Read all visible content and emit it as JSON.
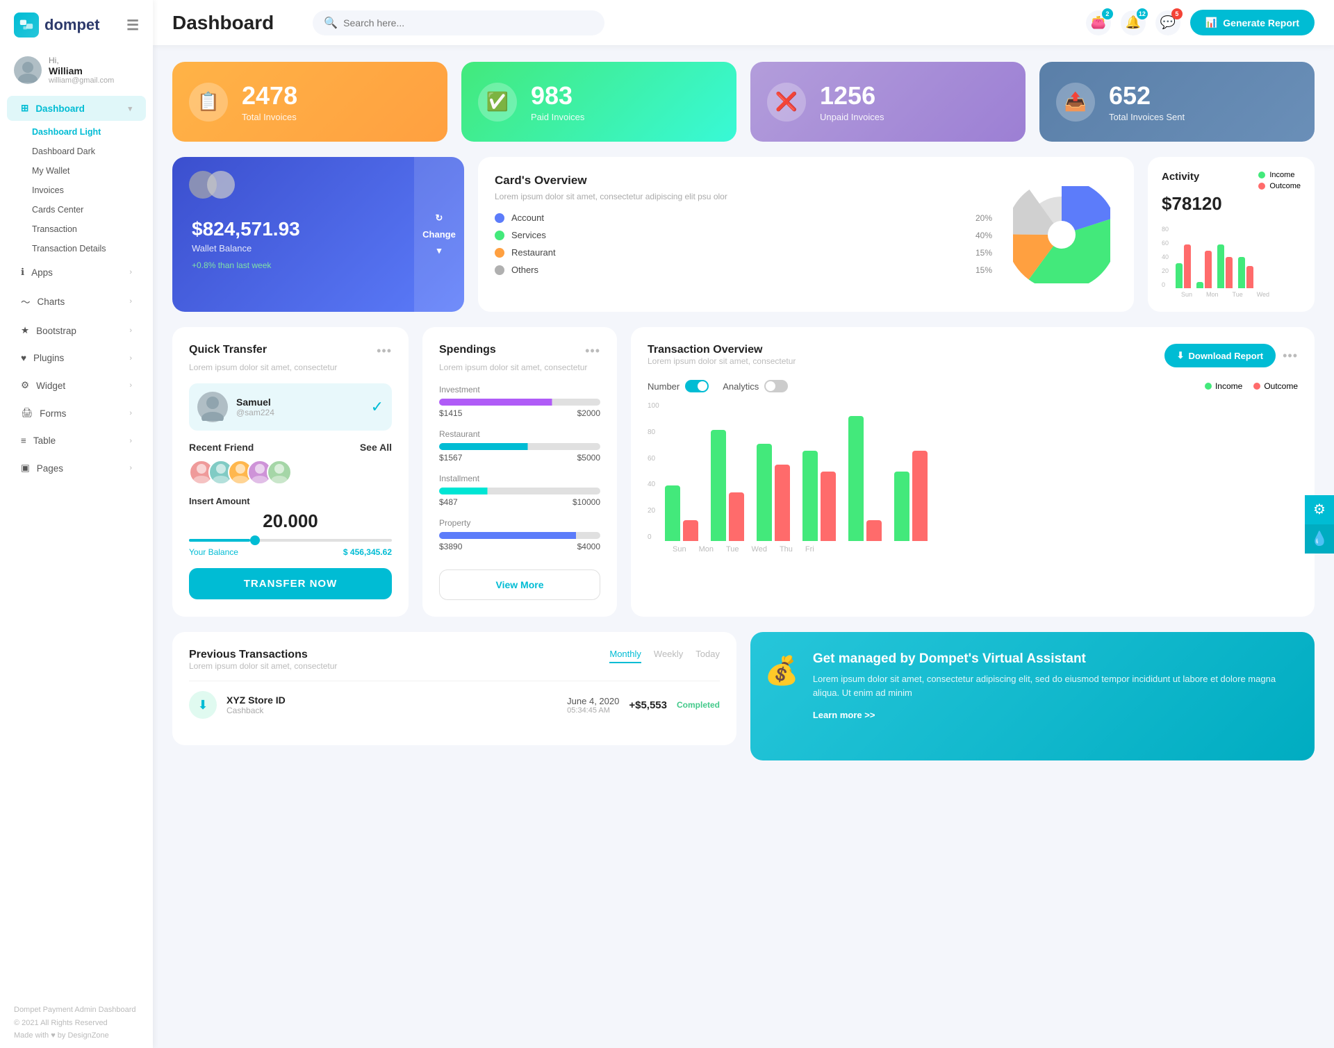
{
  "app": {
    "name": "dompet",
    "title": "Dashboard"
  },
  "header": {
    "title": "Dashboard",
    "search_placeholder": "Search here...",
    "generate_btn": "Generate Report",
    "badges": {
      "wallet": "2",
      "bell": "12",
      "chat": "5"
    }
  },
  "user": {
    "greeting": "Hi, William",
    "name": "William",
    "email": "william@gmail.com"
  },
  "sidebar": {
    "dashboard_label": "Dashboard",
    "sub_items": [
      {
        "label": "Dashboard Light",
        "active": true
      },
      {
        "label": "Dashboard Dark",
        "active": false
      },
      {
        "label": "My Wallet",
        "active": false
      },
      {
        "label": "Invoices",
        "active": false
      },
      {
        "label": "Cards Center",
        "active": false
      },
      {
        "label": "Transaction",
        "active": false
      },
      {
        "label": "Transaction Details",
        "active": false
      }
    ],
    "nav_items": [
      {
        "label": "Apps",
        "has_arrow": true
      },
      {
        "label": "Charts",
        "has_arrow": true
      },
      {
        "label": "Bootstrap",
        "has_arrow": true
      },
      {
        "label": "Plugins",
        "has_arrow": true
      },
      {
        "label": "Widget",
        "has_arrow": true
      },
      {
        "label": "Forms",
        "has_arrow": true
      },
      {
        "label": "Table",
        "has_arrow": true
      },
      {
        "label": "Pages",
        "has_arrow": true
      }
    ],
    "footer": "Dompet Payment Admin Dashboard",
    "footer_copy": "© 2021 All Rights Reserved",
    "made_with": "Made with ♥ by DesignZone"
  },
  "stats": [
    {
      "label": "Total Invoices",
      "value": "2478",
      "color": "orange",
      "icon": "📋"
    },
    {
      "label": "Paid Invoices",
      "value": "983",
      "color": "green",
      "icon": "✅"
    },
    {
      "label": "Unpaid Invoices",
      "value": "1256",
      "color": "purple",
      "icon": "❌"
    },
    {
      "label": "Total Invoices Sent",
      "value": "652",
      "color": "blue-gray",
      "icon": "📤"
    }
  ],
  "wallet": {
    "amount": "$824,571.93",
    "label": "Wallet Balance",
    "change": "+0.8% than last week",
    "change_btn": "Change"
  },
  "cards_overview": {
    "title": "Card's Overview",
    "description": "Lorem ipsum dolor sit amet, consectetur adipiscing elit psu olor",
    "categories": [
      {
        "name": "Account",
        "color": "#5c7cfa",
        "pct": "20%"
      },
      {
        "name": "Services",
        "color": "#43e97b",
        "pct": "40%"
      },
      {
        "name": "Restaurant",
        "color": "#ffa040",
        "pct": "15%"
      },
      {
        "name": "Others",
        "color": "#b0b0b0",
        "pct": "15%"
      }
    ]
  },
  "activity": {
    "title": "Activity",
    "amount": "$78120",
    "income_label": "Income",
    "outcome_label": "Outcome",
    "bars": [
      {
        "day": "Sun",
        "income": 40,
        "outcome": 70
      },
      {
        "day": "Mon",
        "income": 10,
        "outcome": 60
      },
      {
        "day": "Tue",
        "income": 70,
        "outcome": 50
      },
      {
        "day": "Wed",
        "income": 50,
        "outcome": 35
      }
    ]
  },
  "quick_transfer": {
    "title": "Quick Transfer",
    "description": "Lorem ipsum dolor sit amet, consectetur",
    "user": {
      "name": "Samuel",
      "handle": "@sam224"
    },
    "recent_friends_label": "Recent Friend",
    "see_all_label": "See All",
    "insert_amount_label": "Insert Amount",
    "amount": "20.000",
    "balance_label": "Your Balance",
    "balance_value": "$ 456,345.62",
    "transfer_btn": "TRANSFER NOW"
  },
  "spendings": {
    "title": "Spendings",
    "description": "Lorem ipsum dolor sit amet, consectetur",
    "items": [
      {
        "label": "Investment",
        "spent": "$1415",
        "total": "$2000",
        "color": "#b05cf7",
        "pct": 70
      },
      {
        "label": "Restaurant",
        "spent": "$1567",
        "total": "$5000",
        "color": "#00bcd4",
        "pct": 55
      },
      {
        "label": "Installment",
        "spent": "$487",
        "total": "$10000",
        "color": "#00e5d4",
        "pct": 30
      },
      {
        "label": "Property",
        "spent": "$3890",
        "total": "$4000",
        "color": "#5c7cfa",
        "pct": 85
      }
    ],
    "view_more_btn": "View More"
  },
  "transaction_overview": {
    "title": "Transaction Overview",
    "description": "Lorem ipsum dolor sit amet, consectetur",
    "download_btn": "Download Report",
    "number_label": "Number",
    "analytics_label": "Analytics",
    "income_label": "Income",
    "outcome_label": "Outcome",
    "bars": [
      {
        "day": "Sun",
        "income": 40,
        "outcome": 15
      },
      {
        "day": "Mon",
        "income": 80,
        "outcome": 35
      },
      {
        "day": "Tue",
        "income": 70,
        "outcome": 55
      },
      {
        "day": "Wed",
        "income": 65,
        "outcome": 50
      },
      {
        "day": "Thu",
        "income": 90,
        "outcome": 15
      },
      {
        "day": "Fri",
        "income": 50,
        "outcome": 65
      }
    ],
    "y_labels": [
      "0",
      "20",
      "40",
      "60",
      "80",
      "100"
    ]
  },
  "prev_transactions": {
    "title": "Previous Transactions",
    "description": "Lorem ipsum dolor sit amet, consectetur",
    "tabs": [
      "Monthly",
      "Weekly",
      "Today"
    ],
    "active_tab": 0,
    "rows": [
      {
        "name": "XYZ Store ID",
        "type": "Cashback",
        "date": "June 4, 2020",
        "time": "05:34:45 AM",
        "amount": "+$5,553",
        "status": "Completed",
        "icon": "⬇"
      }
    ]
  },
  "cta": {
    "title": "Get managed by Dompet's Virtual Assistant",
    "description": "Lorem ipsum dolor sit amet, consectetur adipiscing elit, sed do eiusmod tempor incididunt ut labore et dolore magna aliqua. Ut enim ad minim",
    "link": "Learn more >>"
  }
}
